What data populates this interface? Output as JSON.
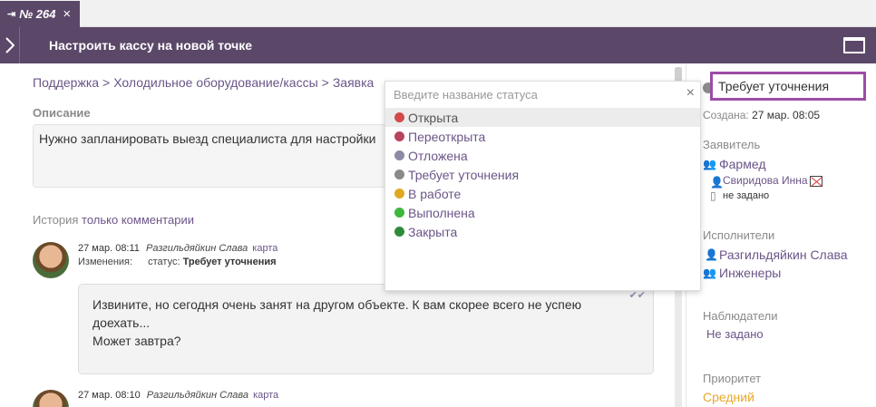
{
  "tab": {
    "label": "№ 264",
    "pin_icon": "pin-icon",
    "close_icon": "close-icon"
  },
  "header": {
    "title": "Настроить кассу на новой точке"
  },
  "breadcrumb": {
    "items": [
      "Поддержка",
      "Холодильное оборудование/кассы",
      "Заявка"
    ],
    "separator": ">"
  },
  "description": {
    "label": "Описание",
    "text": "Нужно запланировать выезд специалиста для настройки"
  },
  "history": {
    "label": "История",
    "filter_label": "только комментарии"
  },
  "comments": [
    {
      "date": "27 мар. 08:11",
      "author": "Разгильдяйкин Слава",
      "map_label": "карта",
      "changes_label": "Изменения:",
      "status_label": "статус:",
      "status_value": "Требует уточнения",
      "body_lines": [
        "Извините, но сегодня очень занят на другом объекте. К вам скорее всего не успею",
        "доехать...",
        "Может завтра?"
      ]
    },
    {
      "date": "27 мар. 08:10",
      "author": "Разгильдяйкин Слава",
      "map_label": "карта"
    }
  ],
  "status_dropdown": {
    "placeholder": "Введите название статуса",
    "options": [
      {
        "label": "Открыта",
        "color": "#d24a4a"
      },
      {
        "label": "Переоткрыта",
        "color": "#b8435f"
      },
      {
        "label": "Отложена",
        "color": "#8d8aa6"
      },
      {
        "label": "Требует уточнения",
        "color": "#8a8a8a"
      },
      {
        "label": "В работе",
        "color": "#e0a820"
      },
      {
        "label": "Выполнена",
        "color": "#3cb83c"
      },
      {
        "label": "Закрыта",
        "color": "#2e8b3c"
      }
    ]
  },
  "sidebar": {
    "status": "Требует уточнения",
    "created_label": "Создана:",
    "created_value": "27 мар. 08:05",
    "requester_label": "Заявитель",
    "requester_org": "Фармед",
    "requester_person": "Свиридова Инна",
    "requester_phone": "не задано",
    "assignees_label": "Исполнители",
    "assignee_person": "Разгильдяйкин Слава",
    "assignee_group": "Инженеры",
    "observers_label": "Наблюдатели",
    "observers_value": "Не задано",
    "priority_label": "Приоритет",
    "priority_value": "Средний"
  },
  "colors": {
    "brand": "#5b4869",
    "link": "#6b5588",
    "highlight_border": "#9b4da6",
    "priority": "#e8a829"
  }
}
